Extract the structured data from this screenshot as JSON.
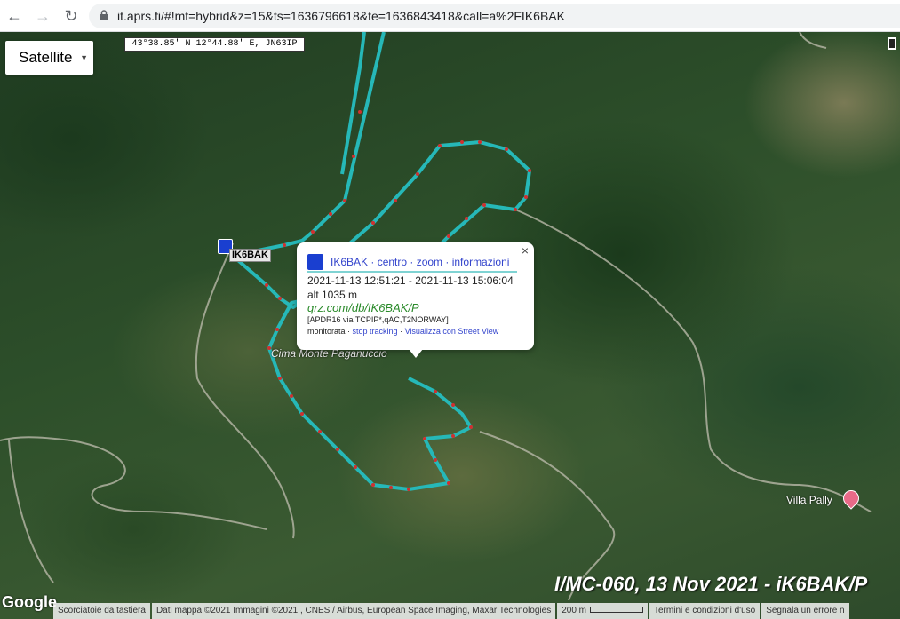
{
  "browser": {
    "url": "it.aprs.fi/#!mt=hybrid&z=15&ts=1636796618&te=1636843418&call=a%2FIK6BAK",
    "back_icon": "arrow-left-icon",
    "forward_icon": "arrow-right-icon",
    "reload_icon": "reload-icon",
    "lock_icon": "lock-icon"
  },
  "map": {
    "type_label": "Satellite",
    "coordinates": "43°38.85' N 12°44.88' E, JN63IP",
    "station_label": "IK6BAK",
    "track_color": "#26b8b8",
    "track_dot_color": "#d03030",
    "places": {
      "cima": "Cima Monte Paganuccio",
      "villa": "Villa Pally"
    },
    "caption": "I/MC-060, 13 Nov 2021 - iK6BAK/P",
    "google": "Google"
  },
  "infowindow": {
    "callsign": "IK6BAK",
    "links": " · centro · zoom · informazioni",
    "time_range": "2021-11-13 12:51:21 - 2021-11-13 15:06:04",
    "altitude": "alt 1035 m",
    "qrz": "qrz.com/db/IK6BAK/P",
    "path": "[APDR16 via TCPIP*,qAC,T2NORWAY]",
    "status": "monitorata · ",
    "stop_tracking": "stop tracking",
    "sep": " · ",
    "street_view": "Visualizza con Street View",
    "close": "×"
  },
  "footer": {
    "shortcuts": "Scorciatoie da tastiera",
    "data": "Dati mappa ©2021 Immagini ©2021 , CNES / Airbus, European Space Imaging, Maxar Technologies",
    "scale": "200 m",
    "terms": "Termini e condizioni d'uso",
    "report": "Segnala un errore n"
  }
}
